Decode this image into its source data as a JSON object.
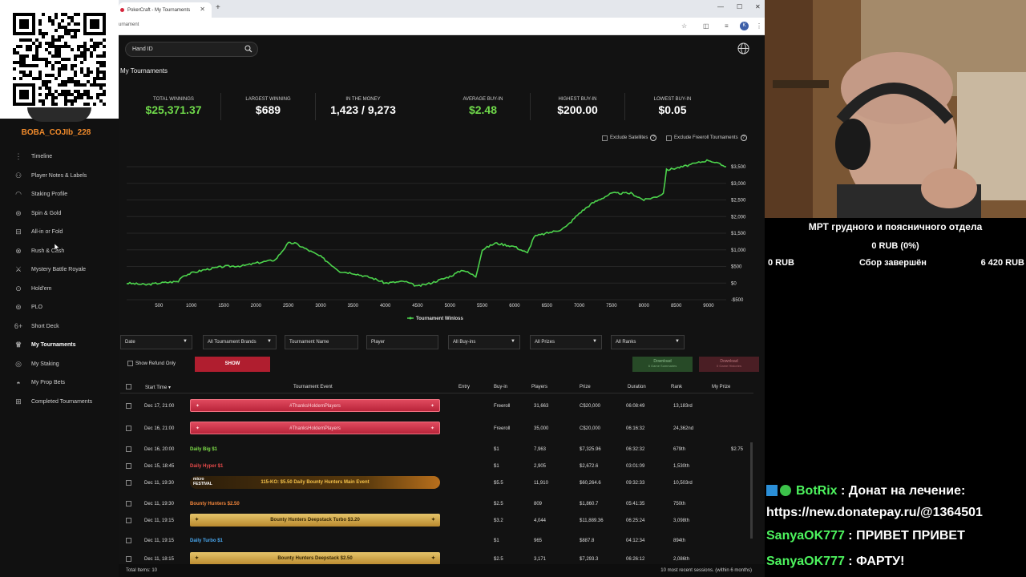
{
  "browser": {
    "tab_title": "PokerCraft - My Tournaments",
    "url": "urnament",
    "profile_initial": "K"
  },
  "user": {
    "name": "BOBA_COJIb_228"
  },
  "sidebar": {
    "items": [
      {
        "label": "Timeline",
        "icon": "timeline-icon"
      },
      {
        "label": "Player Notes & Labels",
        "icon": "notes-icon"
      },
      {
        "label": "Staking Profile",
        "icon": "staking-icon"
      },
      {
        "label": "Spin & Gold",
        "icon": "spin-icon"
      },
      {
        "label": "All-in or Fold",
        "icon": "allin-icon"
      },
      {
        "label": "Rush & Cash",
        "icon": "rush-icon",
        "hover": true
      },
      {
        "label": "Mystery Battle Royale",
        "icon": "battle-icon"
      },
      {
        "label": "Hold'em",
        "icon": "holdem-icon"
      },
      {
        "label": "PLO",
        "icon": "plo-icon"
      },
      {
        "label": "Short Deck",
        "icon": "shortdeck-icon"
      },
      {
        "label": "My Tournaments",
        "icon": "trophy-icon",
        "active": true
      },
      {
        "label": "My Staking",
        "icon": "mystaking-icon"
      },
      {
        "label": "My Prop Bets",
        "icon": "propbets-icon"
      },
      {
        "label": "Completed Tournaments",
        "icon": "completed-icon"
      }
    ]
  },
  "search": {
    "placeholder": "Hand ID"
  },
  "page_title": "My Tournaments",
  "stats": [
    {
      "label": "TOTAL WINNINGS",
      "value": "$25,371.37",
      "green": true
    },
    {
      "label": "LARGEST WINNING",
      "value": "$689"
    },
    {
      "label": "IN THE MONEY",
      "value": "1,423 / 9,273"
    },
    {
      "label": "AVERAGE BUY-IN",
      "value": "$2.48",
      "green": true
    },
    {
      "label": "HIGHEST BUY-IN",
      "value": "$200.00"
    },
    {
      "label": "LOWEST BUY-IN",
      "value": "$0.05"
    }
  ],
  "options": {
    "exclude_satellites": "Exclude Satellites",
    "exclude_freeroll": "Exclude Freeroll Tournaments"
  },
  "chart_data": {
    "type": "line",
    "legend": "Tournament Winloss",
    "x_ticks": [
      500,
      1000,
      1500,
      2000,
      2500,
      3000,
      3500,
      4000,
      4500,
      5000,
      5500,
      6000,
      6500,
      7000,
      7500,
      8000,
      8500,
      9000
    ],
    "y_ticks": [
      "$3,500",
      "$3,000",
      "$2,500",
      "$2,000",
      "$1,500",
      "$1,000",
      "$500",
      "$0",
      "-$500"
    ],
    "xlim": [
      0,
      9273
    ],
    "ylim": [
      -500,
      3500
    ],
    "series": [
      {
        "name": "Tournament Winloss",
        "color": "#4cd34c",
        "x": [
          0,
          300,
          500,
          800,
          850,
          1000,
          1200,
          1500,
          1800,
          2000,
          2300,
          2500,
          2600,
          3000,
          3300,
          3500,
          3800,
          4000,
          4300,
          4500,
          4700,
          5000,
          5200,
          5400,
          5500,
          5700,
          6000,
          6200,
          6300,
          6500,
          6700,
          6800,
          7000,
          7200,
          7400,
          7500,
          7800,
          8000,
          8200,
          8300,
          8350,
          8600,
          8800,
          9000,
          9273
        ],
        "y": [
          0,
          -50,
          0,
          50,
          200,
          300,
          400,
          500,
          520,
          600,
          700,
          1200,
          1200,
          800,
          350,
          300,
          150,
          0,
          50,
          -100,
          0,
          200,
          400,
          200,
          1000,
          1200,
          1100,
          900,
          1400,
          1500,
          1600,
          1700,
          2100,
          2400,
          2600,
          2700,
          2700,
          2500,
          2600,
          2700,
          3400,
          3500,
          3600,
          3700,
          3500
        ]
      }
    ]
  },
  "filters": [
    {
      "label": "Date",
      "arrow": true
    },
    {
      "label": "All Tournament Brands",
      "arrow": true
    },
    {
      "label": "Tournament Name"
    },
    {
      "label": "Player"
    },
    {
      "label": "All Buy-ins",
      "arrow": true
    },
    {
      "label": "All Prizes",
      "arrow": true
    },
    {
      "label": "All Ranks",
      "arrow": true
    }
  ],
  "refund_label": "Show Refund Only",
  "show_button": "SHOW",
  "download": [
    {
      "label": "Download",
      "sub": "6 Game Summaries"
    },
    {
      "label": "Download",
      "sub": "0 Game Histories"
    }
  ],
  "table": {
    "headers": {
      "start": "Start Time",
      "event": "Tournament Event",
      "entry": "Entry",
      "buyin": "Buy-in",
      "players": "Players",
      "prize": "Prize",
      "duration": "Duration",
      "rank": "Rank",
      "myprize": "My Prize"
    },
    "rows": [
      {
        "start": "Dec 17, 21:00",
        "event": "#ThanksHoldemPlayers",
        "style": "pink",
        "buyin": "Freeroll",
        "players": "31,663",
        "prize": "C$20,000",
        "duration": "06:08:49",
        "rank": "13,183rd",
        "myprize": ""
      },
      {
        "start": "Dec 16, 21:00",
        "event": "#ThanksHoldemPlayers",
        "style": "pink",
        "buyin": "Freeroll",
        "players": "35,000",
        "prize": "C$20,000",
        "duration": "06:16:32",
        "rank": "24,362nd",
        "myprize": ""
      },
      {
        "start": "Dec 16, 20:00",
        "event": "Daily Big $1",
        "style": "text",
        "color": "#7fe04a",
        "buyin": "$1",
        "players": "7,963",
        "prize": "$7,325.96",
        "duration": "06:32:32",
        "rank": "679th",
        "myprize": "$2.75"
      },
      {
        "start": "Dec 15, 18:45",
        "event": "Daily Hyper $1",
        "style": "text",
        "color": "#e84a4a",
        "buyin": "$1",
        "players": "2,905",
        "prize": "$2,672.6",
        "duration": "03:01:09",
        "rank": "1,530th",
        "myprize": ""
      },
      {
        "start": "Dec 11, 19:30",
        "event": "115-KO: $5.50 Daily Bounty Hunters Main Event",
        "logo": "micro\nFESTIVAL",
        "style": "dark",
        "buyin": "$5.5",
        "players": "11,910",
        "prize": "$60,264.6",
        "duration": "09:32:33",
        "rank": "10,503rd",
        "myprize": ""
      },
      {
        "start": "Dec 11, 19:30",
        "event": "Bounty Hunters $2.50",
        "style": "text",
        "color": "#f0843a",
        "buyin": "$2.5",
        "players": "809",
        "prize": "$1,860.7",
        "duration": "05:41:35",
        "rank": "750th",
        "myprize": ""
      },
      {
        "start": "Dec 11, 19:15",
        "event": "Bounty Hunters Deepstack Turbo $3.20",
        "style": "gold",
        "buyin": "$3.2",
        "players": "4,044",
        "prize": "$11,889.36",
        "duration": "06:25:24",
        "rank": "3,098th",
        "myprize": ""
      },
      {
        "start": "Dec 11, 19:15",
        "event": "Daily Turbo $1",
        "style": "text",
        "color": "#4aa8f0",
        "buyin": "$1",
        "players": "965",
        "prize": "$887.8",
        "duration": "04:12:34",
        "rank": "894th",
        "myprize": ""
      },
      {
        "start": "Dec 11, 18:15",
        "event": "Bounty Hunters Deepstack $2.50",
        "style": "gold",
        "buyin": "$2.5",
        "players": "3,171",
        "prize": "$7,293.3",
        "duration": "06:26:12",
        "rank": "2,086th",
        "myprize": ""
      }
    ]
  },
  "footer": {
    "total": "Total Items: 10",
    "recent": "10 most recent sessions. (within 6 months)"
  },
  "donation": {
    "title": "МРТ грудного и поясничного отдела",
    "progress_rub": "0 RUB (0%)",
    "collected": "0 RUB",
    "status": "Сбор завершён",
    "goal": "6 420 RUB",
    "progress_fraction": 0
  },
  "chat": [
    {
      "nick": "BotRix",
      "text": " : Донат на лечение:",
      "badges": true
    },
    {
      "nick": "",
      "text": "https://new.donatepay.ru/@1364501"
    },
    {
      "nick": "SanyaOK777",
      "text": " : ПРИВЕТ ПРИВЕТ"
    },
    {
      "nick": "SanyaOK777",
      "text": " : ФАРТУ!"
    }
  ]
}
